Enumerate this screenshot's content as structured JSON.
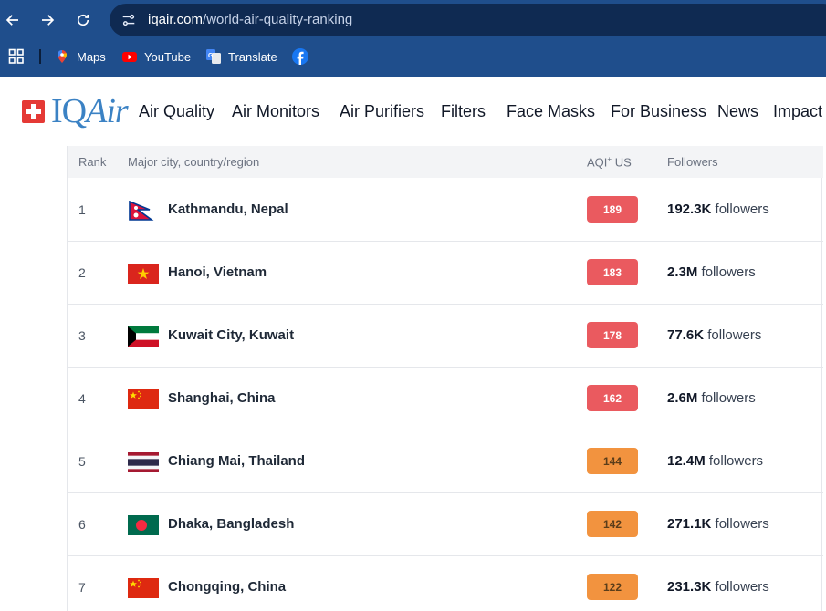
{
  "browser": {
    "url_host": "iqair.com",
    "url_path": "/world-air-quality-ranking",
    "bookmarks": [
      {
        "label": "Maps",
        "icon": "maps-icon"
      },
      {
        "label": "YouTube",
        "icon": "youtube-icon"
      },
      {
        "label": "Translate",
        "icon": "translate-icon"
      },
      {
        "label": "",
        "icon": "facebook-icon"
      }
    ]
  },
  "site": {
    "logo_iq": "IQ",
    "logo_air": "Air",
    "nav": [
      "Air Quality",
      "Air Monitors",
      "Air Purifiers",
      "Filters",
      "Face Masks",
      "For Business",
      "News",
      "Impact"
    ]
  },
  "table": {
    "headers": {
      "rank": "Rank",
      "city": "Major city, country/region",
      "aqi": "AQI",
      "aqi_sup": "+",
      "aqi_suffix": " US",
      "followers": "Followers"
    },
    "followers_word": "followers",
    "colors": {
      "red": "#ea5a5f",
      "orange": "#f2933f"
    },
    "rows": [
      {
        "rank": "1",
        "city": "Kathmandu, Nepal",
        "flag": "nepal",
        "aqi": "189",
        "level": "red",
        "followers": "192.3K"
      },
      {
        "rank": "2",
        "city": "Hanoi, Vietnam",
        "flag": "vietnam",
        "aqi": "183",
        "level": "red",
        "followers": "2.3M"
      },
      {
        "rank": "3",
        "city": "Kuwait City, Kuwait",
        "flag": "kuwait",
        "aqi": "178",
        "level": "red",
        "followers": "77.6K"
      },
      {
        "rank": "4",
        "city": "Shanghai, China",
        "flag": "china",
        "aqi": "162",
        "level": "red",
        "followers": "2.6M"
      },
      {
        "rank": "5",
        "city": "Chiang Mai, Thailand",
        "flag": "thailand",
        "aqi": "144",
        "level": "orange",
        "followers": "12.4M"
      },
      {
        "rank": "6",
        "city": "Dhaka, Bangladesh",
        "flag": "bangladesh",
        "aqi": "142",
        "level": "orange",
        "followers": "271.1K"
      },
      {
        "rank": "7",
        "city": "Chongqing, China",
        "flag": "china",
        "aqi": "122",
        "level": "orange",
        "followers": "231.3K"
      }
    ]
  }
}
